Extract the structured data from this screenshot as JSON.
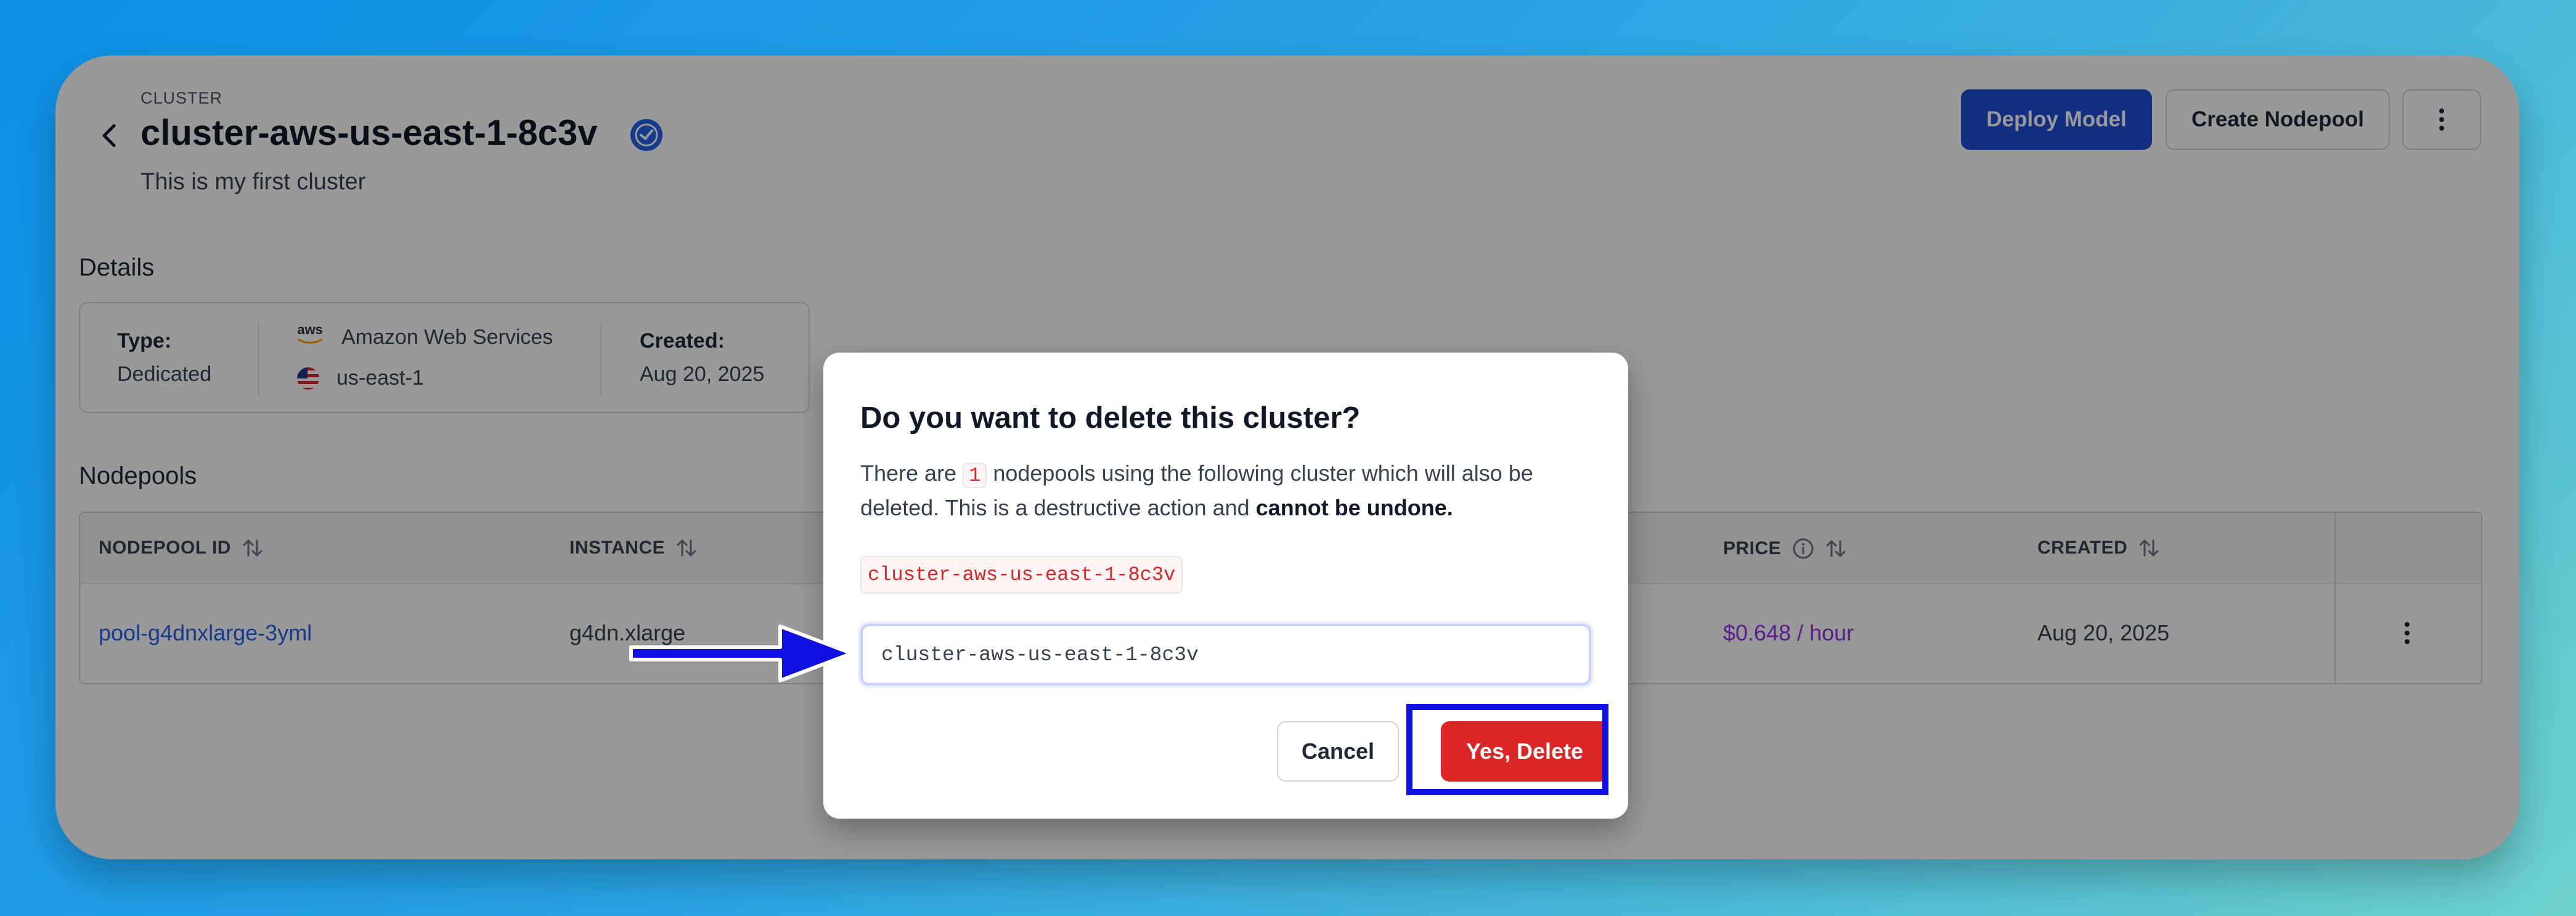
{
  "header": {
    "crumb": "CLUSTER",
    "title": "cluster-aws-us-east-1-8c3v",
    "subtitle": "This is my first cluster",
    "deploy_label": "Deploy Model",
    "create_nodepool_label": "Create Nodepool"
  },
  "details": {
    "section_label": "Details",
    "type_label": "Type:",
    "type_value": "Dedicated",
    "provider_logo_text": "aws",
    "provider": "Amazon Web Services",
    "region": "us-east-1",
    "created_label": "Created:",
    "created_value": "Aug 20, 2025"
  },
  "nodepools": {
    "section_label": "Nodepools",
    "columns": [
      "NODEPOOL ID",
      "INSTANCE",
      "PRICE",
      "CREATED"
    ],
    "row": {
      "id": "pool-g4dnxlarge-3yml",
      "instance": "g4dn.xlarge",
      "price": "$0.648 / hour",
      "created": "Aug 20, 2025"
    }
  },
  "modal": {
    "title": "Do you want to delete this cluster?",
    "body_prefix": "There are",
    "count": "1",
    "body_middle": "nodepools using the following cluster which will also be deleted. This is a destructive action and",
    "body_strong": "cannot be undone.",
    "cluster_name": "cluster-aws-us-east-1-8c3v",
    "input_value": "cluster-aws-us-east-1-8c3v",
    "cancel_label": "Cancel",
    "delete_label": "Yes, Delete"
  },
  "colors": {
    "primary": "#1d4ed8",
    "danger": "#dc2626",
    "price": "#9333ea",
    "link": "#2563eb",
    "annotation": "#1010e0"
  }
}
